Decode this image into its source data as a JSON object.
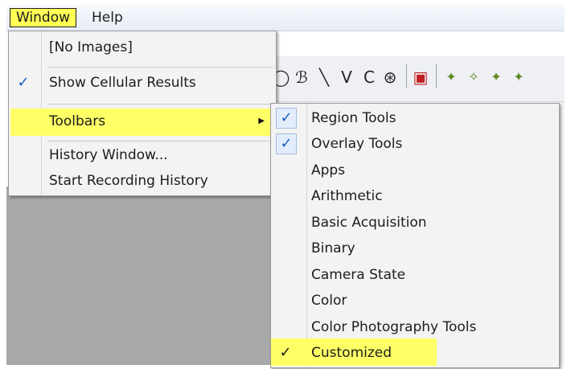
{
  "menubar": {
    "window_label": "Window",
    "help_label": "Help"
  },
  "window_menu": {
    "items": [
      {
        "label": "[No Images]"
      },
      {
        "label": "Show Cellular Results",
        "checked": true
      },
      {
        "label": "Toolbars",
        "submenu": true,
        "highlighted": true
      },
      {
        "label": "History Window..."
      },
      {
        "label": "Start Recording History"
      }
    ]
  },
  "toolbars_menu": {
    "items": [
      {
        "label": "Region Tools",
        "checked": true
      },
      {
        "label": "Overlay Tools",
        "checked": true
      },
      {
        "label": "Apps"
      },
      {
        "label": "Arithmetic"
      },
      {
        "label": "Basic Acquisition"
      },
      {
        "label": "Binary"
      },
      {
        "label": "Camera State"
      },
      {
        "label": "Color"
      },
      {
        "label": "Color Photography Tools"
      },
      {
        "label": "Customized",
        "checked": true,
        "highlighted": true
      }
    ]
  },
  "toolbar_icons": [
    "ellipse-tool-icon",
    "freehand-region-icon",
    "line-tool-icon",
    "polyline-tool-icon",
    "arc-tool-icon",
    "multi-point-icon",
    "region-manager-icon",
    "wizard-icon",
    "wizard-icon",
    "wizard-icon"
  ],
  "colors": {
    "highlight": "#ffff66",
    "check": "#1b5fc0",
    "workspace": "#a8a8a8"
  }
}
